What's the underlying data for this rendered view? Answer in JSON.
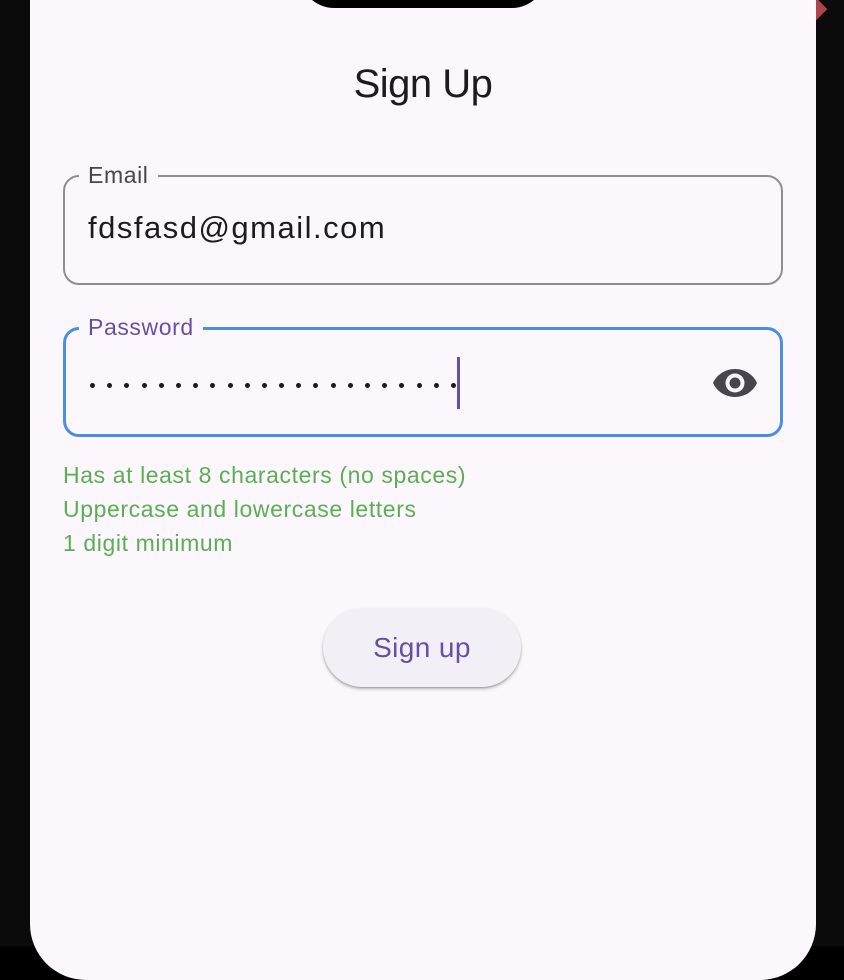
{
  "screen": {
    "title": "Sign Up"
  },
  "form": {
    "email": {
      "label": "Email",
      "value": "fdsfasd@gmail.com"
    },
    "password": {
      "label": "Password",
      "masked_length": 22,
      "toggle_icon": "eye-icon"
    },
    "hints": [
      "Has at least 8 characters (no spaces)",
      "Uppercase and lowercase letters",
      "1 digit minimum"
    ],
    "submit_label": "Sign up"
  },
  "colors": {
    "accent": "#6750a4",
    "focus_border": "#4a8fe0",
    "hint_ok": "#5cae55",
    "background": "#fcf7fc"
  }
}
